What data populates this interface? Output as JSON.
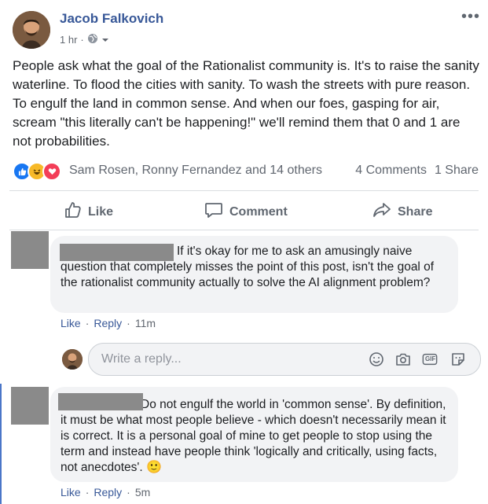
{
  "post": {
    "author": "Jacob Falkovich",
    "time": "1 hr",
    "more_label": "•••",
    "text": "People ask what the goal of the Rationalist community is. It's to raise the sanity waterline. To flood the cities with sanity. To wash the streets with pure reason. To engulf the land in common sense. And when our foes, gasping for air, scream \"this literally can't be happening!\" we'll remind them that 0 and 1 are not probabilities."
  },
  "reactions": {
    "names": "Sam Rosen, Ronny Fernandez and 14 others",
    "comments": "4 Comments",
    "shares": "1 Share"
  },
  "actions": {
    "like": "Like",
    "comment": "Comment",
    "share": "Share"
  },
  "comments": [
    {
      "text": "If it's okay for me to ask an amusingly naive question that completely misses the point of this post, isn't the goal of the rationalist community actually to solve the AI alignment problem?",
      "like": "Like",
      "reply": "Reply",
      "time": "11m"
    },
    {
      "text": "Do not engulf the world in 'common sense'. By definition, it must be what most people believe - which doesn't necessarily mean it is correct. It is a personal goal of mine to get people to stop using the term and instead have people think 'logically and critically, using facts, not anecdotes'.",
      "emoji": "🙂",
      "like": "Like",
      "reply": "Reply",
      "time": "5m"
    }
  ],
  "reply_box": {
    "placeholder": "Write a reply...",
    "gif_label": "GIF"
  },
  "colors": {
    "link": "#385898",
    "secondary": "#616770",
    "like_blue": "#1877f2",
    "haha_yellow": "#f7b928",
    "love_red": "#f33e58",
    "bubble": "#f2f3f5"
  }
}
